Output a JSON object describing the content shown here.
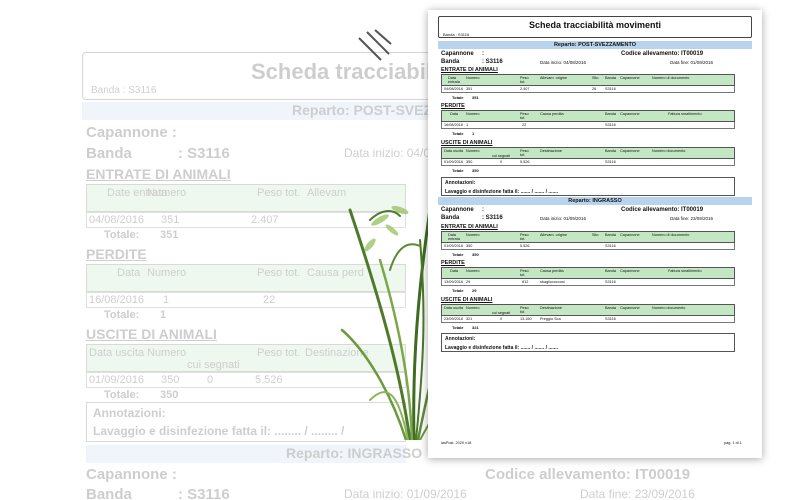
{
  "doc": {
    "title": "Scheda tracciabilità movimenti",
    "banda_header": "Banda : S3116",
    "footer_left": "iasPost. 2020 v18",
    "footer_right": "pag. 1 di 1",
    "annotazioni_label": "Annotazioni:",
    "lavaggio_text": "Lavaggio e disinfezione fatta il: ....... / ....... / .......",
    "capannone_label": "Capannone",
    "banda_label": "Banda",
    "colon": ":",
    "sections": [
      {
        "reparto": "Reparto: POST-SVEZZAMENTO",
        "codice": "Codice allevamento: IT00019",
        "banda_value": ": S3116",
        "date_inizio": "Data inizio: 04/08/2016",
        "date_fine": "Data fine: 01/09/2016",
        "entrate": {
          "title": "ENTRATE DI ANIMALI",
          "headers": [
            "Data entrata",
            "Numero",
            "Peso tot.",
            "Allevam. origine",
            "Sito",
            "Banda",
            "Capannone",
            "Numero di documento"
          ],
          "row": [
            "04/08/2016",
            "351",
            "2.407",
            "",
            "26",
            "S3116",
            "",
            ""
          ],
          "total_label": "Totale",
          "total": "351"
        },
        "perdite": {
          "title": "PERDITE",
          "headers": [
            "Data",
            "Numero",
            "Peso tot.",
            "Causa perdita",
            "Banda",
            "Capannone",
            "Fattura smaltimento"
          ],
          "row": [
            "16/08/2016",
            "1",
            "22",
            "",
            "S3116",
            "",
            ""
          ],
          "total_label": "Totale",
          "total": "1"
        },
        "uscite": {
          "title": "USCITE DI ANIMALI",
          "headers": [
            "Data uscita",
            "Numero",
            "cui segnati",
            "Peso tot.",
            "Destinazione",
            "Banda",
            "Capannone",
            "Numero documento"
          ],
          "row": [
            "01/09/2016",
            "350",
            "0",
            "5.526",
            "",
            "S3116",
            "",
            ""
          ],
          "total_label": "Totale",
          "total": "350"
        }
      },
      {
        "reparto": "Reparto: INGRASSO",
        "codice": "Codice allevamento: IT00019",
        "banda_value": ": S3116",
        "date_inizio": "Data inizio: 01/09/2016",
        "date_fine": "Data fine: 23/09/2016",
        "entrate": {
          "title": "ENTRATE DI ANIMALI",
          "headers": [
            "Data entrata",
            "Numero",
            "Peso tot.",
            "Allevam. origine",
            "Sito",
            "Banda",
            "Capannone",
            "Numero di documento"
          ],
          "row": [
            "01/09/2016",
            "350",
            "5.526",
            "",
            "",
            "S3116",
            "",
            ""
          ],
          "total_label": "Totale",
          "total": "350"
        },
        "perdite": {
          "title": "PERDITE",
          "headers": [
            "Data",
            "Numero",
            "Peso tot.",
            "Causa perdita",
            "Banda",
            "Capannone",
            "Fattura smaltimento"
          ],
          "row": [
            "13/09/2016",
            "29",
            "812",
            "sbagliococcosi",
            "S3116",
            "",
            ""
          ],
          "total_label": "Totale",
          "total": "29"
        },
        "uscite": {
          "title": "USCITE DI ANIMALI",
          "headers": [
            "Data uscita",
            "Numero",
            "cui segnati",
            "Peso tot.",
            "Destinazione",
            "Banda",
            "Capannone",
            "Numero documento"
          ],
          "row": [
            "23/09/2016",
            "321",
            "0",
            "13.160",
            "Preggio Sca",
            "S3116",
            "",
            ""
          ],
          "total_label": "Totale",
          "total": "321"
        }
      }
    ]
  },
  "background": {
    "title": "Scheda tracciabilità",
    "banda_header": "Banda : S3116",
    "reparto1": "Reparto: POST-SVEZ",
    "capannone": "Capannone   :",
    "banda": "Banda",
    "banda_value": ": S3116",
    "data_inizio1": "Data inizio: 04/0",
    "entrate": "ENTRATE DI ANIMALI",
    "entrate_headers": [
      "Date entrata",
      "Numero",
      "Peso tot.",
      "Allevam"
    ],
    "entrate_row": [
      "04/08/2016",
      "351",
      "2.407"
    ],
    "entrate_total_label": "Totale:",
    "entrate_total": "351",
    "perdite": "PERDITE",
    "perdite_headers": [
      "Data",
      "Numero",
      "Peso tot.",
      "Causa perd"
    ],
    "perdite_row": [
      "16/08/2016",
      "1",
      "22"
    ],
    "perdite_total_label": "Totale:",
    "perdite_total": "1",
    "uscite": "USCITE DI ANIMALI",
    "uscite_headers": [
      "Data uscita",
      "Numero",
      "cui segnati",
      "Peso tot.",
      "Destinazione"
    ],
    "uscite_row": [
      "01/09/2016",
      "350",
      "0",
      "5.526"
    ],
    "uscite_total_label": "Totale:",
    "uscite_total": "350",
    "annotazioni": "Annotazioni:",
    "lavaggio": "Lavaggio e disinfezione fatta il: ........ / ........ /",
    "reparto2": "Reparto: INGRASSO",
    "capannone2": "Capannone   :",
    "codice2": "Codice allevamento: IT00019",
    "banda2": "Banda",
    "banda2_value": ": S3116",
    "data_inizio2": "Data inizio: 01/09/2016",
    "data_fine2": "Data fine: 23/09/2016"
  }
}
